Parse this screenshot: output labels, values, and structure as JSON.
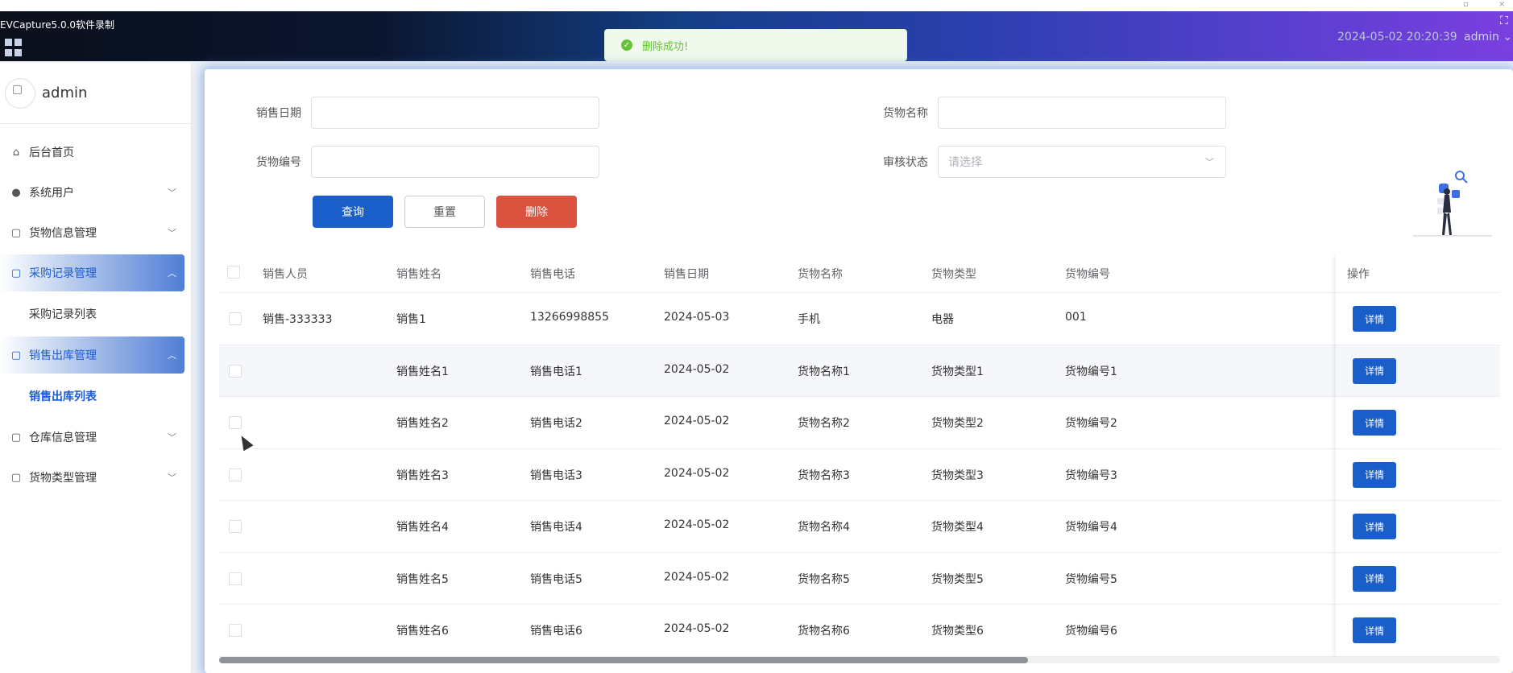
{
  "window": {
    "recorder_label": "EVCapture5.0.0软件录制"
  },
  "header": {
    "datetime": "2024-05-02 20:20:39",
    "user_menu": "admin"
  },
  "toast": {
    "message": "删除成功!",
    "color": "#67c23a"
  },
  "sidebar": {
    "user_name": "admin",
    "items": [
      {
        "label": "后台首页",
        "icon": "home-icon",
        "glyph": "⌂"
      },
      {
        "label": "系统用户",
        "icon": "user-icon",
        "glyph": "👤"
      },
      {
        "label": "货物信息管理",
        "icon": "doc-icon",
        "glyph": "▢"
      },
      {
        "label": "采购记录管理",
        "icon": "doc-icon",
        "glyph": "▢",
        "sub": "采购记录列表"
      },
      {
        "label": "销售出库管理",
        "icon": "doc-icon",
        "glyph": "▢",
        "sub": "销售出库列表"
      },
      {
        "label": "仓库信息管理",
        "icon": "doc-icon",
        "glyph": "▢"
      },
      {
        "label": "货物类型管理",
        "icon": "doc-icon",
        "glyph": "▢"
      }
    ]
  },
  "search": {
    "sale_date_label": "销售日期",
    "goods_name_label": "货物名称",
    "goods_code_label": "货物编号",
    "review_status_label": "审核状态",
    "review_status_placeholder": "请选择",
    "query_label": "查询",
    "reset_label": "重置",
    "delete_label": "删除"
  },
  "table": {
    "columns": [
      "销售人员",
      "销售姓名",
      "销售电话",
      "销售日期",
      "货物名称",
      "货物类型",
      "货物编号",
      "操作"
    ],
    "detail_label": "详情",
    "rows": [
      [
        "销售-333333",
        "销售1",
        "13266998855",
        "2024-05-03",
        "手机",
        "电器",
        "001"
      ],
      [
        "",
        "销售姓名1",
        "销售电话1",
        "2024-05-02",
        "货物名称1",
        "货物类型1",
        "货物编号1"
      ],
      [
        "",
        "销售姓名2",
        "销售电话2",
        "2024-05-02",
        "货物名称2",
        "货物类型2",
        "货物编号2"
      ],
      [
        "",
        "销售姓名3",
        "销售电话3",
        "2024-05-02",
        "货物名称3",
        "货物类型3",
        "货物编号3"
      ],
      [
        "",
        "销售姓名4",
        "销售电话4",
        "2024-05-02",
        "货物名称4",
        "货物类型4",
        "货物编号4"
      ],
      [
        "",
        "销售姓名5",
        "销售电话5",
        "2024-05-02",
        "货物名称5",
        "货物类型5",
        "货物编号5"
      ],
      [
        "",
        "销售姓名6",
        "销售电话6",
        "2024-05-02",
        "货物名称6",
        "货物类型6",
        "货物编号6"
      ]
    ]
  },
  "colors": {
    "primary": "#1a5fc9",
    "danger": "#d9533f",
    "active_menu": "#1a5bd6"
  }
}
